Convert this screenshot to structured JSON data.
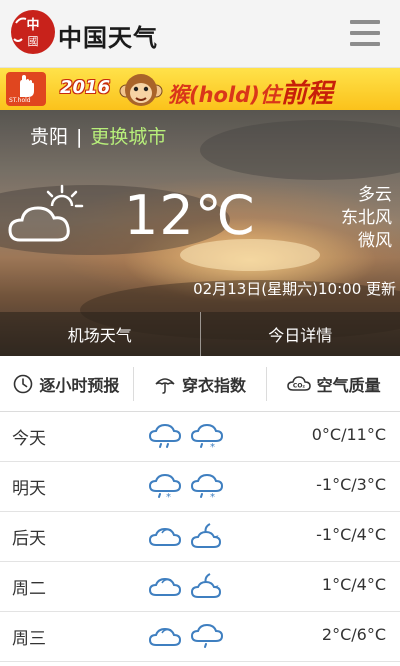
{
  "header": {
    "brand": "中国天气",
    "logo_icon": "china-weather-seal-logo",
    "menu_icon": "hamburger-menu-icon"
  },
  "banner": {
    "year": "2016",
    "slogan_main": "猴(hold)住",
    "slogan_tail": "前程",
    "hand_label": "ST.hold"
  },
  "current": {
    "city": "贵阳",
    "separator": "|",
    "change_city": "更换城市",
    "temperature": "12℃",
    "condition": "多云",
    "wind_direction": "东北风",
    "wind_level": "微风",
    "updated": "02月13日(星期六)10:00 更新",
    "icon": "partly-cloudy-icon"
  },
  "tabs": [
    {
      "label": "机场天气"
    },
    {
      "label": "今日详情"
    }
  ],
  "features": [
    {
      "label": "逐小时预报",
      "icon": "clock-icon"
    },
    {
      "label": "穿衣指数",
      "icon": "umbrella-icon"
    },
    {
      "label": "空气质量",
      "icon": "air-quality-cloud-icon"
    }
  ],
  "forecast": [
    {
      "day": "今天",
      "icon_day": "rain-icon",
      "icon_night": "sleet-icon",
      "range": "0°C/11°C"
    },
    {
      "day": "明天",
      "icon_day": "sleet-icon",
      "icon_night": "sleet-icon",
      "range": "-1°C/3°C"
    },
    {
      "day": "后天",
      "icon_day": "cloudy-icon",
      "icon_night": "moon-cloud-icon",
      "range": "-1°C/4°C"
    },
    {
      "day": "周二",
      "icon_day": "cloudy-icon",
      "icon_night": "moon-cloud-icon",
      "range": "1°C/4°C"
    },
    {
      "day": "周三",
      "icon_day": "cloudy-icon",
      "icon_night": "rain-icon",
      "range": "2°C/6°C"
    }
  ],
  "colors": {
    "accent_green": "#b7ee7a",
    "icon_blue": "#3f7fc0",
    "banner_yellow": "#fbc21b",
    "logo_red": "#c8221b"
  }
}
